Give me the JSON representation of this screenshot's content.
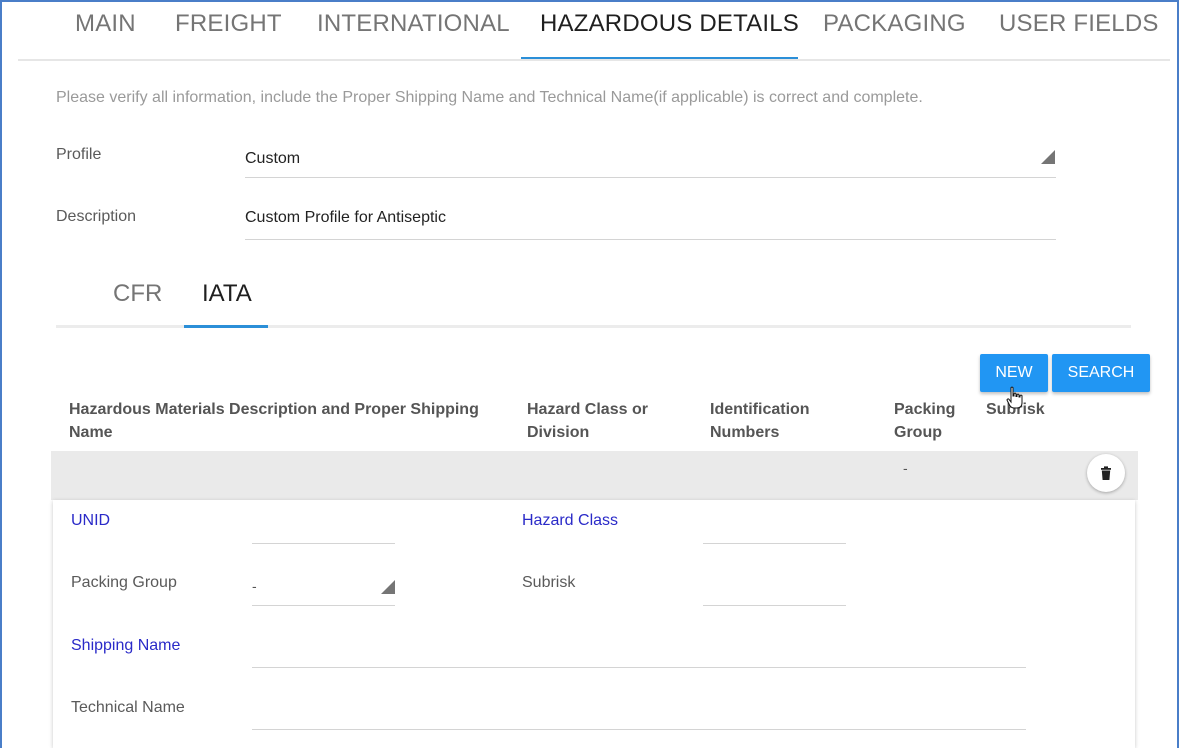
{
  "top_tabs": [
    {
      "label": "MAIN"
    },
    {
      "label": "FREIGHT"
    },
    {
      "label": "INTERNATIONAL"
    },
    {
      "label": "HAZARDOUS DETAILS",
      "active": true
    },
    {
      "label": "PACKAGING"
    },
    {
      "label": "USER FIELDS"
    }
  ],
  "notice": "Please verify all information, include the Proper Shipping Name and Technical Name(if applicable) is correct and complete.",
  "profile": {
    "label": "Profile",
    "value": "Custom"
  },
  "description": {
    "label": "Description",
    "value": "Custom Profile for Antiseptic"
  },
  "sub_tabs": [
    {
      "label": "CFR"
    },
    {
      "label": "IATA",
      "active": true
    }
  ],
  "buttons": {
    "new": "NEW",
    "search": "SEARCH"
  },
  "table": {
    "columns": [
      "Hazardous Materials Description and Proper Shipping Name",
      "Hazard Class or Division",
      "Identification Numbers",
      "Packing Group",
      "Subrisk"
    ],
    "rows": [
      {
        "description": "",
        "hazard_class": "",
        "identification": "",
        "packing_group": "-",
        "subrisk": ""
      }
    ]
  },
  "detail": {
    "unid": {
      "label": "UNID",
      "value": ""
    },
    "hazard_class": {
      "label": "Hazard Class",
      "value": ""
    },
    "packing_group": {
      "label": "Packing Group",
      "value": "-"
    },
    "subrisk": {
      "label": "Subrisk",
      "value": ""
    },
    "shipping_name": {
      "label": "Shipping Name",
      "value": ""
    },
    "technical_name": {
      "label": "Technical Name",
      "value": ""
    }
  },
  "colors": {
    "accent": "#2196f3",
    "required_label": "#2a2ac8",
    "frame": "#4a7ec8"
  },
  "icons": {
    "trash": "trash-icon",
    "select": "dropdown-triangle-icon",
    "cursor": "hand-pointer-icon"
  }
}
